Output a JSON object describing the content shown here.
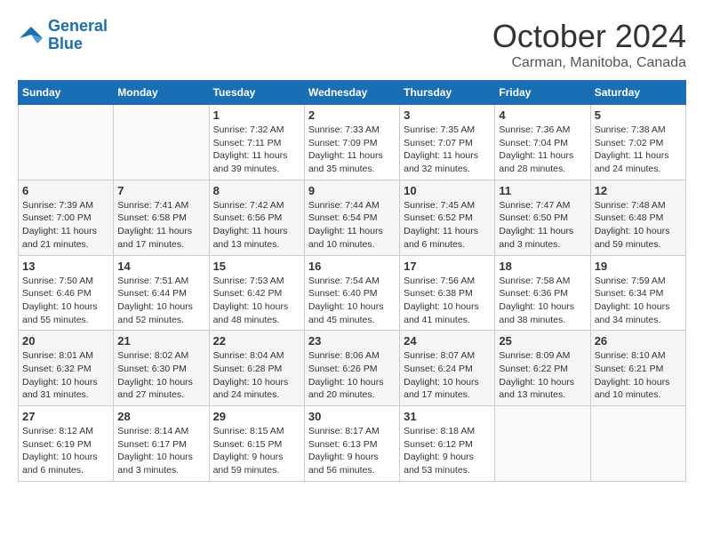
{
  "logo": {
    "line1": "General",
    "line2": "Blue"
  },
  "title": "October 2024",
  "location": "Carman, Manitoba, Canada",
  "weekdays": [
    "Sunday",
    "Monday",
    "Tuesday",
    "Wednesday",
    "Thursday",
    "Friday",
    "Saturday"
  ],
  "weeks": [
    [
      {
        "day": "",
        "info": ""
      },
      {
        "day": "",
        "info": ""
      },
      {
        "day": "1",
        "info": "Sunrise: 7:32 AM\nSunset: 7:11 PM\nDaylight: 11 hours and 39 minutes."
      },
      {
        "day": "2",
        "info": "Sunrise: 7:33 AM\nSunset: 7:09 PM\nDaylight: 11 hours and 35 minutes."
      },
      {
        "day": "3",
        "info": "Sunrise: 7:35 AM\nSunset: 7:07 PM\nDaylight: 11 hours and 32 minutes."
      },
      {
        "day": "4",
        "info": "Sunrise: 7:36 AM\nSunset: 7:04 PM\nDaylight: 11 hours and 28 minutes."
      },
      {
        "day": "5",
        "info": "Sunrise: 7:38 AM\nSunset: 7:02 PM\nDaylight: 11 hours and 24 minutes."
      }
    ],
    [
      {
        "day": "6",
        "info": "Sunrise: 7:39 AM\nSunset: 7:00 PM\nDaylight: 11 hours and 21 minutes."
      },
      {
        "day": "7",
        "info": "Sunrise: 7:41 AM\nSunset: 6:58 PM\nDaylight: 11 hours and 17 minutes."
      },
      {
        "day": "8",
        "info": "Sunrise: 7:42 AM\nSunset: 6:56 PM\nDaylight: 11 hours and 13 minutes."
      },
      {
        "day": "9",
        "info": "Sunrise: 7:44 AM\nSunset: 6:54 PM\nDaylight: 11 hours and 10 minutes."
      },
      {
        "day": "10",
        "info": "Sunrise: 7:45 AM\nSunset: 6:52 PM\nDaylight: 11 hours and 6 minutes."
      },
      {
        "day": "11",
        "info": "Sunrise: 7:47 AM\nSunset: 6:50 PM\nDaylight: 11 hours and 3 minutes."
      },
      {
        "day": "12",
        "info": "Sunrise: 7:48 AM\nSunset: 6:48 PM\nDaylight: 10 hours and 59 minutes."
      }
    ],
    [
      {
        "day": "13",
        "info": "Sunrise: 7:50 AM\nSunset: 6:46 PM\nDaylight: 10 hours and 55 minutes."
      },
      {
        "day": "14",
        "info": "Sunrise: 7:51 AM\nSunset: 6:44 PM\nDaylight: 10 hours and 52 minutes."
      },
      {
        "day": "15",
        "info": "Sunrise: 7:53 AM\nSunset: 6:42 PM\nDaylight: 10 hours and 48 minutes."
      },
      {
        "day": "16",
        "info": "Sunrise: 7:54 AM\nSunset: 6:40 PM\nDaylight: 10 hours and 45 minutes."
      },
      {
        "day": "17",
        "info": "Sunrise: 7:56 AM\nSunset: 6:38 PM\nDaylight: 10 hours and 41 minutes."
      },
      {
        "day": "18",
        "info": "Sunrise: 7:58 AM\nSunset: 6:36 PM\nDaylight: 10 hours and 38 minutes."
      },
      {
        "day": "19",
        "info": "Sunrise: 7:59 AM\nSunset: 6:34 PM\nDaylight: 10 hours and 34 minutes."
      }
    ],
    [
      {
        "day": "20",
        "info": "Sunrise: 8:01 AM\nSunset: 6:32 PM\nDaylight: 10 hours and 31 minutes."
      },
      {
        "day": "21",
        "info": "Sunrise: 8:02 AM\nSunset: 6:30 PM\nDaylight: 10 hours and 27 minutes."
      },
      {
        "day": "22",
        "info": "Sunrise: 8:04 AM\nSunset: 6:28 PM\nDaylight: 10 hours and 24 minutes."
      },
      {
        "day": "23",
        "info": "Sunrise: 8:06 AM\nSunset: 6:26 PM\nDaylight: 10 hours and 20 minutes."
      },
      {
        "day": "24",
        "info": "Sunrise: 8:07 AM\nSunset: 6:24 PM\nDaylight: 10 hours and 17 minutes."
      },
      {
        "day": "25",
        "info": "Sunrise: 8:09 AM\nSunset: 6:22 PM\nDaylight: 10 hours and 13 minutes."
      },
      {
        "day": "26",
        "info": "Sunrise: 8:10 AM\nSunset: 6:21 PM\nDaylight: 10 hours and 10 minutes."
      }
    ],
    [
      {
        "day": "27",
        "info": "Sunrise: 8:12 AM\nSunset: 6:19 PM\nDaylight: 10 hours and 6 minutes."
      },
      {
        "day": "28",
        "info": "Sunrise: 8:14 AM\nSunset: 6:17 PM\nDaylight: 10 hours and 3 minutes."
      },
      {
        "day": "29",
        "info": "Sunrise: 8:15 AM\nSunset: 6:15 PM\nDaylight: 9 hours and 59 minutes."
      },
      {
        "day": "30",
        "info": "Sunrise: 8:17 AM\nSunset: 6:13 PM\nDaylight: 9 hours and 56 minutes."
      },
      {
        "day": "31",
        "info": "Sunrise: 8:18 AM\nSunset: 6:12 PM\nDaylight: 9 hours and 53 minutes."
      },
      {
        "day": "",
        "info": ""
      },
      {
        "day": "",
        "info": ""
      }
    ]
  ]
}
